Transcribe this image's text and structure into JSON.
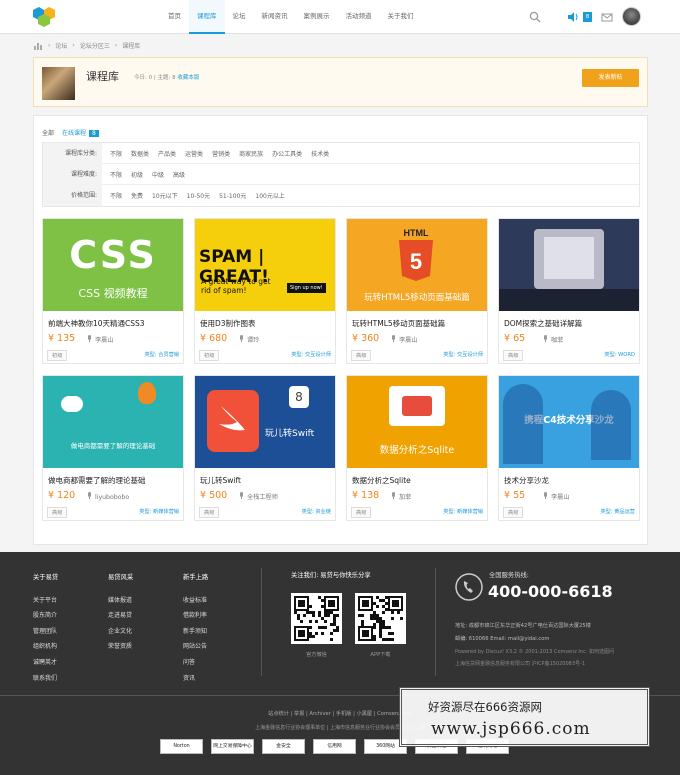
{
  "nav": {
    "items": [
      "首页",
      "课程库",
      "论坛",
      "新闻资讯",
      "案例展示",
      "活动频道",
      "关于我们"
    ],
    "active": 1,
    "msg_count": "8"
  },
  "breadcrumb": [
    "论坛",
    "论坛分区三",
    "课程库"
  ],
  "forum": {
    "title": "课程库",
    "today_label": "今日: 0",
    "topics_label": "主题: 8",
    "favorite": "收藏本版",
    "post_button": "发表新帖"
  },
  "tabs": {
    "all": "全部",
    "online": "在线课程",
    "online_count": "8"
  },
  "filters": [
    {
      "label": "课程库分类:",
      "options": [
        "不限",
        "数据类",
        "产品类",
        "运营类",
        "营销类",
        "商家民族",
        "办公工具类",
        "技术类"
      ]
    },
    {
      "label": "课程难度:",
      "options": [
        "不限",
        "初级",
        "中级",
        "高级"
      ]
    },
    {
      "label": "价格范围:",
      "options": [
        "不限",
        "免费",
        "10元以下",
        "10-50元",
        "51-100元",
        "100元以上"
      ]
    }
  ],
  "courses": [
    {
      "name": "前端大神教你10天精通CSS3",
      "price": "¥ 135",
      "author": "李晨山",
      "level": "初级",
      "type": "类型: 合员营销",
      "img_text": "CSS",
      "img_sub": "CSS 视频教程",
      "color": "#7ec144"
    },
    {
      "name": "使用D3制作图表",
      "price": "¥ 680",
      "author": "谭玲",
      "level": "初级",
      "type": "类型: 交互设计师",
      "img_text": "SPAM | GREAT!",
      "img_sub": "A great way to get rid of spam!",
      "img_btn": "Sign up now!",
      "color": "#f6cf0c"
    },
    {
      "name": "玩转HTML5移动页面基础篇",
      "price": "¥ 360",
      "author": "李晨山",
      "level": "高级",
      "type": "类型: 交互设计师",
      "img_text": "HTML",
      "img_sub": "玩转HTML5移动页面基础篇",
      "color": "#f5a623"
    },
    {
      "name": "DOM探索之基础详解篇",
      "price": "¥ 65",
      "author": "咖菲",
      "level": "高级",
      "type": "类型: WORD",
      "color": "#2e3a5a"
    },
    {
      "name": "做电商都需要了解的理论基础",
      "price": "¥ 120",
      "author": "liyubobobo",
      "level": "高级",
      "type": "类型: 新媒体营销",
      "img_sub": "做电商都需要了解的理论基础",
      "color": "#2bb3b1"
    },
    {
      "name": "玩儿转Swift",
      "price": "¥ 500",
      "author": "全栈工程师",
      "level": "高级",
      "type": "类型: 资业链",
      "img_text": "玩儿转Swift",
      "color": "#1d4f96"
    },
    {
      "name": "数据分析之Sqlite",
      "price": "¥ 138",
      "author": "加菲",
      "level": "高级",
      "type": "类型: 新媒体营销",
      "img_text": "数据分析之Sqlite",
      "color": "#f0a300"
    },
    {
      "name": "技术分享沙龙",
      "price": "¥ 55",
      "author": "李晨山",
      "level": "高级",
      "type": "类型: 黄品运营",
      "img_text": "携程C4技术分享沙龙",
      "color": "#3aa1e0"
    }
  ],
  "footer": {
    "cols": [
      {
        "title": "关于易贷",
        "items": [
          "关于平台",
          "股东简介",
          "管理团队",
          "组织机构",
          "诚聘英才",
          "联系我们"
        ]
      },
      {
        "title": "易贷风采",
        "items": [
          "媒体报道",
          "走进易贷",
          "企业文化",
          "荣誉资质"
        ]
      },
      {
        "title": "新手上路",
        "items": [
          "收益标准",
          "借款利率",
          "新手须知",
          "网站公告",
          "问答",
          "资讯"
        ]
      }
    ],
    "follow": "关注我们: 易贷与你快乐分享",
    "qr": [
      "官方微信",
      "APP下载"
    ],
    "hotline_label": "全国服务热线:",
    "hotline": "400-000-6618",
    "address": "地址: 成都市锦江区东华正街42号广电仕百达国际大厦25楼",
    "contact": "邮编: 610066  Email: mail@yidai.com",
    "powered": "Powered by Discuz! X3.2 © 2001-2013 Comsenz Inc. 如何选图问",
    "copyright": "上海信贷网金融信息服务有限公司  沪ICP备15020083号-1",
    "links": "站点统计  |  举报  |  Archiver  |  手机版  |  小黑屋  |  Comsenz Inc.",
    "sub": "上海金融信息行业协会理事单位 | 上海市信息服务业行业协会会员单位 | 上海",
    "certs": [
      "Norton",
      "网上交易保障中心",
      "金安全",
      "信用网",
      "360网站",
      "安全认证",
      "透明网站"
    ]
  },
  "watermark": {
    "line1": "好资源尽在666资源网",
    "line2": "www.jsp666.com"
  }
}
